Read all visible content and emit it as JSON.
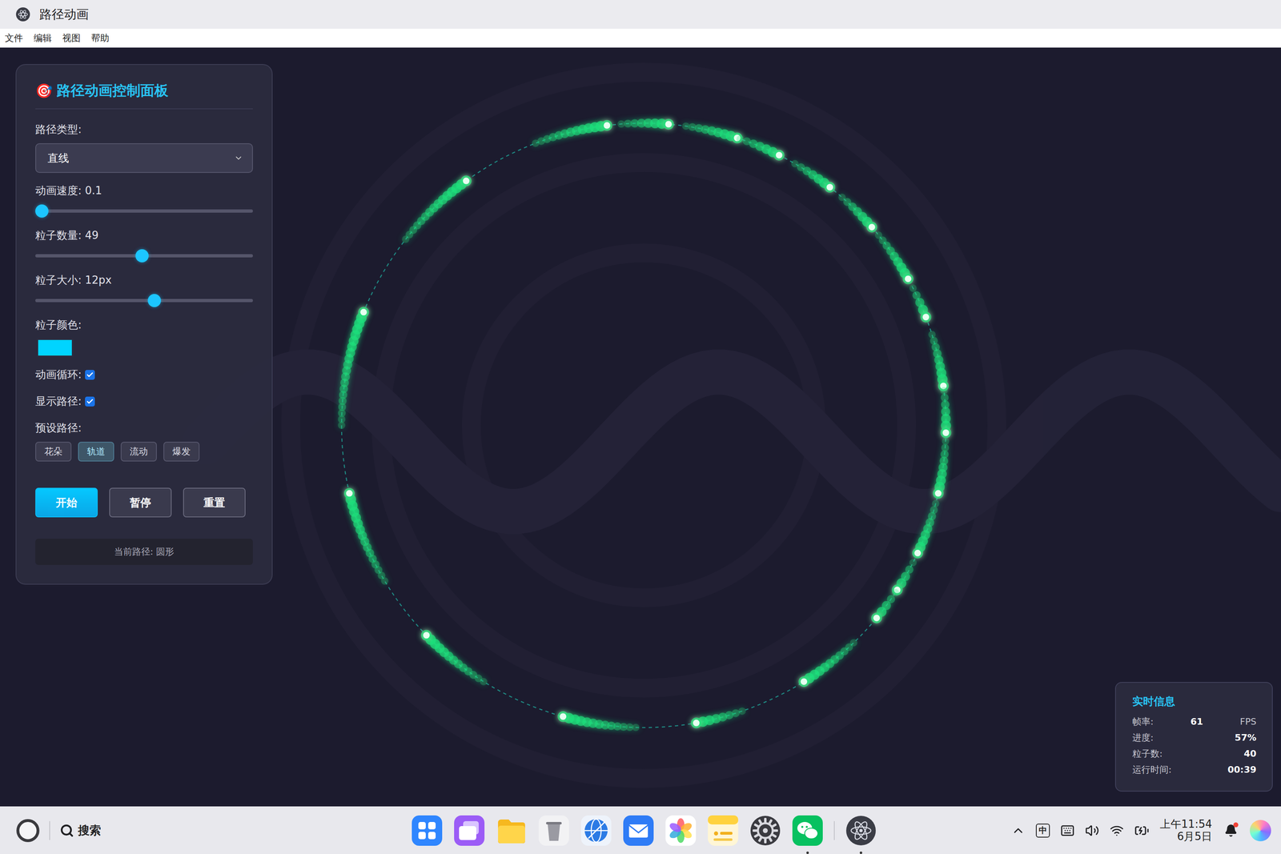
{
  "window": {
    "title": "路径动画"
  },
  "menu": [
    "文件",
    "编辑",
    "视图",
    "帮助"
  ],
  "panel": {
    "title_icon": "🎯",
    "title": "路径动画控制面板",
    "controls": [
      {
        "kind": "select",
        "label": "路径类型:",
        "value": "直线"
      },
      {
        "kind": "slider",
        "label": "动画速度: 0.1",
        "level": 0.0
      },
      {
        "kind": "slider",
        "label": "粒子数量: 49",
        "level": 0.49
      },
      {
        "kind": "slider",
        "label": "粒子大小: 12px",
        "level": 0.55
      },
      {
        "kind": "color",
        "label": "粒子颜色:",
        "color": "#00d4ff"
      },
      {
        "kind": "checkbox",
        "label": "动画循环:",
        "checked": true
      },
      {
        "kind": "checkbox",
        "label": "显示路径:",
        "checked": true
      }
    ],
    "presets": {
      "label": "预设路径:",
      "items": [
        {
          "label": "花朵",
          "selected": false
        },
        {
          "label": "轨道",
          "selected": true
        },
        {
          "label": "流动",
          "selected": false
        },
        {
          "label": "爆发",
          "selected": false
        }
      ]
    },
    "actions": [
      {
        "label": "开始",
        "primary": true
      },
      {
        "label": "暂停",
        "primary": false
      },
      {
        "label": "重置",
        "primary": false
      }
    ],
    "status": "当前路径: 圆形"
  },
  "info": {
    "title": "实时信息",
    "rows": [
      {
        "label": "帧率:",
        "value": "61",
        "unit": "FPS"
      },
      {
        "label": "进度:",
        "value": "57%"
      },
      {
        "label": "粒子数:",
        "value": "40"
      },
      {
        "label": "运行时间:",
        "value": "00:39"
      }
    ]
  },
  "taskbar": {
    "search": "搜索",
    "apps": [
      {
        "kind": "launcher",
        "running": false
      },
      {
        "kind": "multitask",
        "running": false
      },
      {
        "kind": "files",
        "running": false
      },
      {
        "kind": "trash",
        "running": false
      },
      {
        "kind": "browser",
        "running": false
      },
      {
        "kind": "mail",
        "running": false
      },
      {
        "kind": "photos",
        "running": false
      },
      {
        "kind": "notes",
        "running": false
      },
      {
        "kind": "settings",
        "running": false
      },
      {
        "kind": "wechat",
        "running": true
      },
      {
        "kind": "pathapp",
        "running": true
      }
    ],
    "tray": {
      "ime": "中",
      "time": "上午11:54",
      "date": "6月5日",
      "bell_unread": true
    }
  }
}
